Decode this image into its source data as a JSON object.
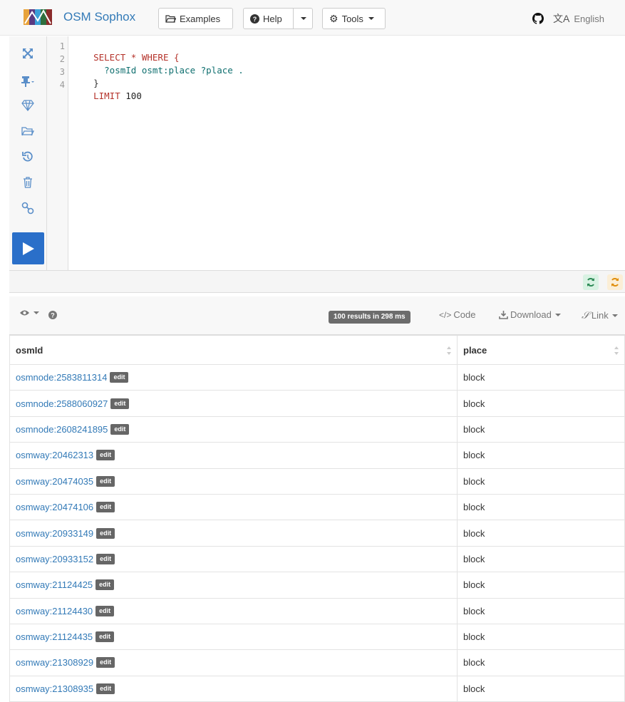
{
  "navbar": {
    "brand": "OSM Sophox",
    "examples_label": "Examples",
    "help_label": "Help",
    "tools_label": "Tools",
    "language": "English"
  },
  "editor": {
    "lines": [
      {
        "no": "1",
        "tokens": [
          {
            "t": "SELECT * WHERE {",
            "c": "kw"
          }
        ]
      },
      {
        "no": "2",
        "tokens": [
          {
            "t": "  ?osmId osmt:place ?place .",
            "c": "var"
          }
        ]
      },
      {
        "no": "3",
        "tokens": [
          {
            "t": "}",
            "c": ""
          }
        ]
      },
      {
        "no": "4",
        "tokens": [
          {
            "t": "LIMIT ",
            "c": "kw"
          },
          {
            "t": "100",
            "c": "num"
          }
        ]
      }
    ]
  },
  "results": {
    "summary": "100 results in 298 ms",
    "code_label": "Code",
    "download_label": "Download",
    "link_label": "Link"
  },
  "table": {
    "columns": [
      "osmId",
      "place"
    ],
    "edit_label": "edit",
    "rows": [
      {
        "id": "osmnode:2583811314",
        "place": "block"
      },
      {
        "id": "osmnode:2588060927",
        "place": "block"
      },
      {
        "id": "osmnode:2608241895",
        "place": "block"
      },
      {
        "id": "osmway:20462313",
        "place": "block"
      },
      {
        "id": "osmway:20474035",
        "place": "block"
      },
      {
        "id": "osmway:20474106",
        "place": "block"
      },
      {
        "id": "osmway:20933149",
        "place": "block"
      },
      {
        "id": "osmway:20933152",
        "place": "block"
      },
      {
        "id": "osmway:21124425",
        "place": "block"
      },
      {
        "id": "osmway:21124430",
        "place": "block"
      },
      {
        "id": "osmway:21124435",
        "place": "block"
      },
      {
        "id": "osmway:21308929",
        "place": "block"
      },
      {
        "id": "osmway:21308935",
        "place": "block"
      }
    ]
  },
  "colors": {
    "link": "#337ab7",
    "run_button": "#2a6fc9",
    "refresh_green": "#2e8b57",
    "refresh_orange": "#e08e0b"
  }
}
